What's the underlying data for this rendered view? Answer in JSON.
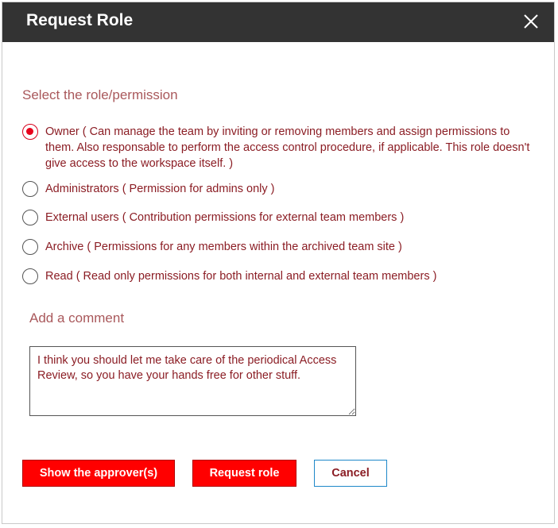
{
  "dialog": {
    "title": "Request Role",
    "close_icon": "close-icon"
  },
  "role_section": {
    "label": "Select the role/permission",
    "options": [
      {
        "label": "Owner ( Can manage the team by inviting or removing members and assign permissions to them. Also responsable to perform the access control procedure, if applicable. This role doesn't give access to the workspace itself. )",
        "selected": true
      },
      {
        "label": "Administrators ( Permission for admins only )",
        "selected": false
      },
      {
        "label": "External users ( Contribution permissions for external team members )",
        "selected": false
      },
      {
        "label": "Archive ( Permissions for any members within the archived team site )",
        "selected": false
      },
      {
        "label": "Read ( Read only permissions for both internal and external team members )",
        "selected": false
      }
    ]
  },
  "comment_section": {
    "label": "Add a comment",
    "value": "I think you should let me take care of the periodical Access Review, so you have your hands free for other stuff."
  },
  "buttons": {
    "show_approvers": "Show the approver(s)",
    "request_role": "Request role",
    "cancel": "Cancel"
  },
  "colors": {
    "header_bg": "#333333",
    "accent_red": "#ff0000",
    "label_text": "#a9585b",
    "option_text": "#8b1d24",
    "cancel_border": "#1e88c9"
  }
}
